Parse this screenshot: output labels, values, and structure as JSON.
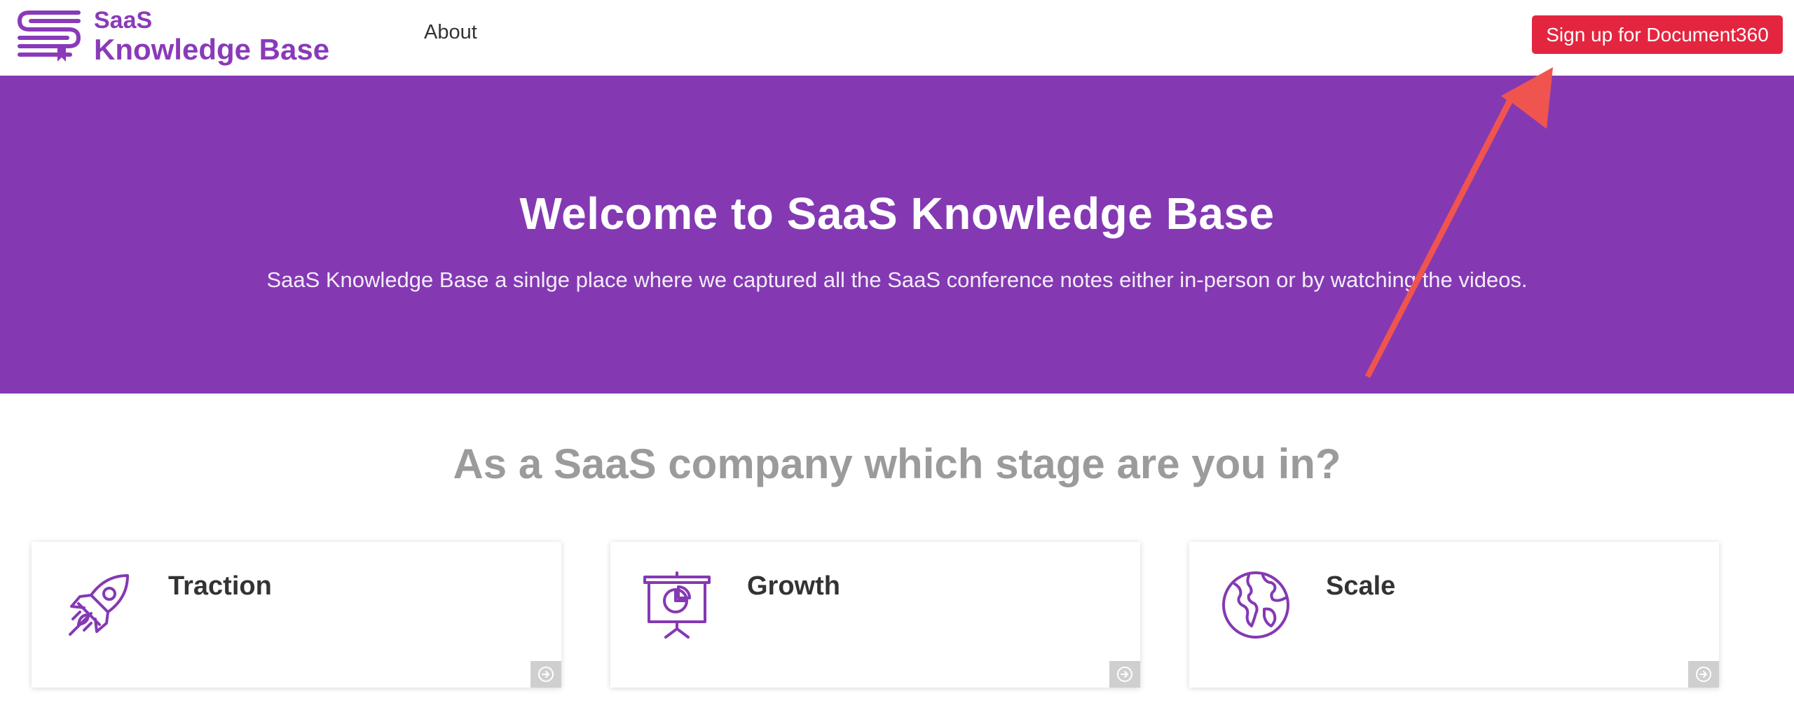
{
  "header": {
    "logo": {
      "line1": "SaaS",
      "line2": "Knowledge Base",
      "icon": "stacked-books-s-logo-icon"
    },
    "nav": {
      "about_label": "About"
    },
    "signup_label": "Sign up for Document360"
  },
  "hero": {
    "title": "Welcome to SaaS Knowledge Base",
    "subtitle": "SaaS Knowledge Base a sinlge place where we captured all the SaaS conference notes either in-person or by watching the videos."
  },
  "stages": {
    "heading": "As a SaaS company which stage are you in?",
    "cards": [
      {
        "title": "Traction",
        "icon": "rocket-icon"
      },
      {
        "title": "Growth",
        "icon": "presentation-board-icon"
      },
      {
        "title": "Scale",
        "icon": "globe-icon"
      }
    ]
  },
  "annotation": {
    "icon": "red-pointer-arrow",
    "color": "#f0544f"
  },
  "colors": {
    "brand_purple": "#8439b3",
    "signup_red": "#e4253f",
    "heading_gray": "#9b9b9b",
    "text_dark": "#333333"
  }
}
